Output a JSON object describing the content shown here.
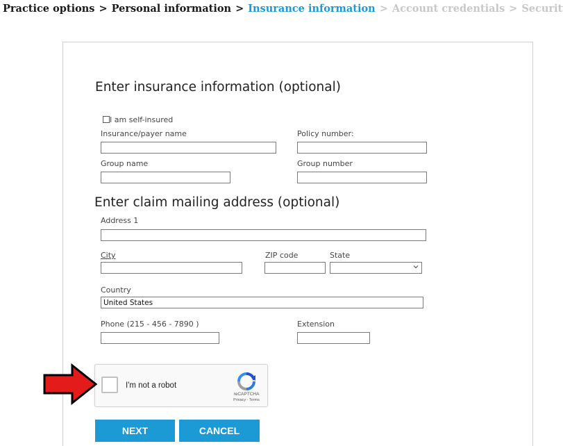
{
  "breadcrumb": {
    "steps": [
      {
        "label": "Practice options"
      },
      {
        "label": "Personal information"
      },
      {
        "label": "Insurance information"
      },
      {
        "label": "Account credentials"
      },
      {
        "label": "Security Questions"
      }
    ],
    "separator": ">"
  },
  "insurance": {
    "heading": "Enter insurance information (optional)",
    "self_insured_label": "I am self-insured",
    "payer_name_label": "Insurance/payer name",
    "payer_name_value": "",
    "policy_number_label": "Policy number:",
    "policy_number_value": "",
    "group_name_label": "Group name",
    "group_name_value": "",
    "group_number_label": "Group number",
    "group_number_value": ""
  },
  "claim_address": {
    "heading": "Enter claim mailing address (optional)",
    "address1_label": "Address 1",
    "address1_value": "",
    "city_label": "City",
    "city_value": "",
    "zip_label": "ZIP code",
    "zip_value": "",
    "state_label": "State",
    "state_value": "",
    "country_label": "Country",
    "country_value": "United States",
    "phone_label": "Phone (215 - 456 - 7890 )",
    "phone_value": "",
    "extension_label": "Extension",
    "extension_value": ""
  },
  "captcha": {
    "label": "I'm not a robot",
    "brand": "reCAPTCHA",
    "links": "Privacy - Terms"
  },
  "buttons": {
    "next": "NEXT",
    "cancel": "CANCEL"
  },
  "colors": {
    "accent": "#1c9ad6",
    "arrow": "#e31b1b"
  },
  "icons": {
    "arrow": "arrow-right-icon",
    "captcha": "recaptcha-icon",
    "select": "chevron-down-icon"
  }
}
